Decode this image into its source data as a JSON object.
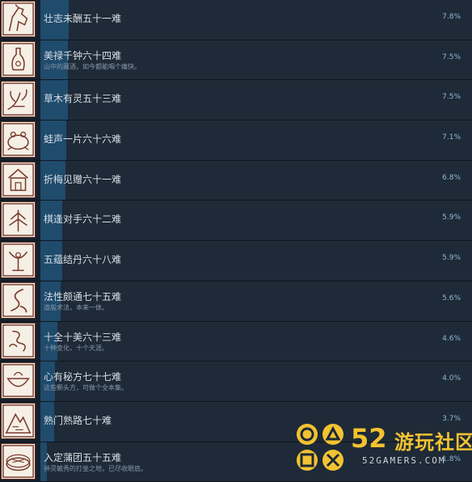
{
  "achievements": [
    {
      "title": "壮志未酬五十一难",
      "desc": "",
      "percent": "7.8%",
      "progress": 0.078,
      "icon": "horse-icon"
    },
    {
      "title": "美禄千钟六十四难",
      "desc": "山中的藏酒，如今都能喝个痛快。",
      "percent": "7.5%",
      "progress": 0.075,
      "icon": "wine-vase-icon"
    },
    {
      "title": "草木有灵五十三难",
      "desc": "",
      "percent": "7.5%",
      "progress": 0.075,
      "icon": "plant-spirit-icon"
    },
    {
      "title": "蛙声一片六十六难",
      "desc": "",
      "percent": "7.1%",
      "progress": 0.071,
      "icon": "frog-icon"
    },
    {
      "title": "折梅见赠六十一难",
      "desc": "",
      "percent": "6.8%",
      "progress": 0.068,
      "icon": "house-icon"
    },
    {
      "title": "棋逢对手六十二难",
      "desc": "",
      "percent": "5.9%",
      "progress": 0.059,
      "icon": "pine-tree-icon"
    },
    {
      "title": "五蕴结丹六十八难",
      "desc": "",
      "percent": "5.9%",
      "progress": 0.059,
      "icon": "elixir-icon"
    },
    {
      "title": "法性颇通七十五难",
      "desc": "道般术法，本来一体。",
      "percent": "5.6%",
      "progress": 0.056,
      "icon": "flame-swirl-icon"
    },
    {
      "title": "十全十美六十三难",
      "desc": "十种变化，十个天涯。",
      "percent": "4.6%",
      "progress": 0.046,
      "icon": "cloud-swirl-icon"
    },
    {
      "title": "心有秘方七十七难",
      "desc": "这些颗头方，可做个全本集。",
      "percent": "4.0%",
      "progress": 0.04,
      "icon": "gourd-bowl-icon"
    },
    {
      "title": "熟门熟路七十难",
      "desc": "",
      "percent": "3.7%",
      "progress": 0.037,
      "icon": "mountain-icon"
    },
    {
      "title": "入定蒲团五十五难",
      "desc": "钟灵毓秀的打坐之地，已尽收眼底。",
      "percent": "1.8%",
      "progress": 0.018,
      "icon": "cushion-icon"
    }
  ],
  "watermark": {
    "number": "52",
    "cn": "游玩社区",
    "en": "52GAMERS.COM"
  }
}
